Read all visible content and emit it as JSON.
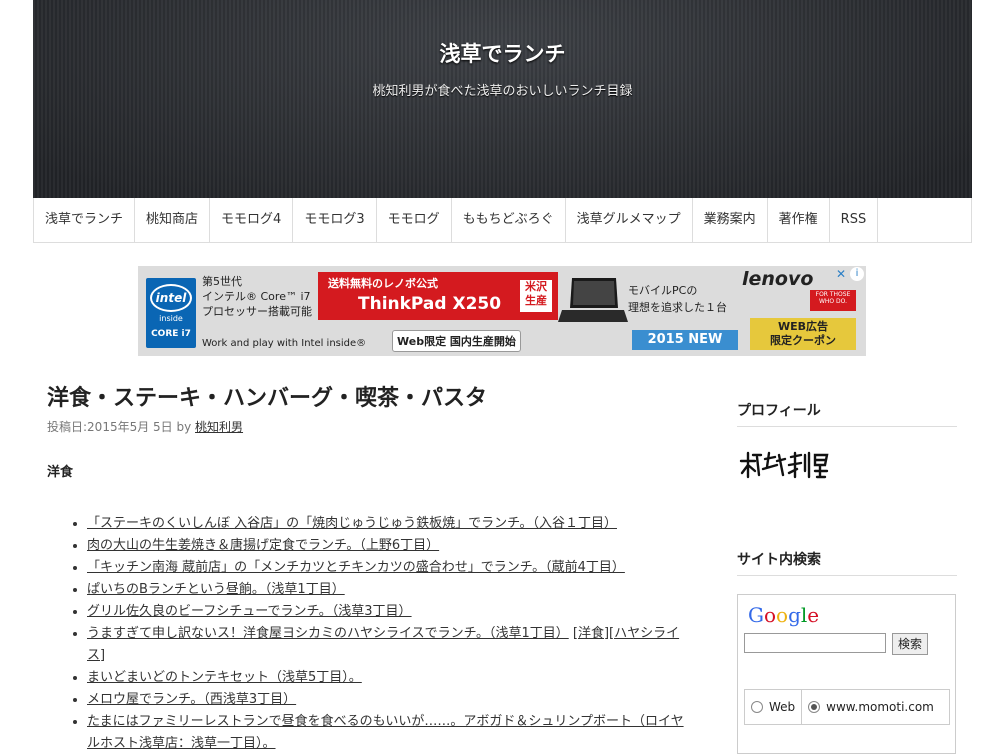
{
  "header": {
    "title": "浅草でランチ",
    "description": "桃知利男が食べた浅草のおいしいランチ目録"
  },
  "nav": [
    "浅草でランチ",
    "桃知商店",
    "モモログ4",
    "モモログ3",
    "モモログ",
    "ももちどぶろぐ",
    "浅草グルメマップ",
    "業務案内",
    "著作権",
    "RSS"
  ],
  "banner": {
    "intel_line1": "第5世代",
    "intel_line2": "インテル® Core™ i7",
    "intel_line3": "プロセッサー搭載可能",
    "intel_logo": "intel",
    "intel_inside": "inside",
    "intel_core": "CORE i7",
    "work_play": "Work and play with Intel inside®",
    "red_line1": "送料無料のレノボ公式",
    "red_line2": "ThinkPad X250",
    "seal": "米沢生産",
    "web_only": "Web限定 国内生産開始",
    "mobile_line1": "モバイルPCの",
    "mobile_line2": "理想を追求した１台",
    "new_2015": "2015 NEW",
    "lenovo": "lenovo",
    "those": "FOR THOSE WHO DO.",
    "coupon_line1": "WEB広告",
    "coupon_line2": "限定クーポン"
  },
  "post": {
    "title": "洋食・ステーキ・ハンバーグ・喫茶・パスタ",
    "meta_prefix": "投稿日:2015年5月 5日 by ",
    "author": "桃知利男",
    "section": "洋食",
    "entries": [
      {
        "link": "「ステーキのくいしんぼ 入谷店」の「焼肉じゅうじゅう鉄板焼」でランチ。（入谷１丁目）",
        "extra": ""
      },
      {
        "link": "肉の大山の牛生姜焼き＆唐揚げ定食でランチ。（上野6丁目）",
        "extra": ""
      },
      {
        "link": "「キッチン南海 蔵前店」の「メンチカツとチキンカツの盛合わせ」でランチ。（蔵前4丁目）",
        "extra": ""
      },
      {
        "link": "ぱいちのBランチという昼餉。（浅草1丁目）",
        "extra": ""
      },
      {
        "link": "グリル佐久良のビーフシチューでランチ。（浅草3丁目）",
        "extra": ""
      },
      {
        "link": "うますぎて申し訳ないス！洋食屋ヨシカミのハヤシライスでランチ。（浅草1丁目）",
        "extra": "[洋食][ハヤシライス]"
      },
      {
        "link": "まいどまいどのトンテキセット（浅草5丁目）。",
        "extra": ""
      },
      {
        "link": "メロウ屋でランチ。（西浅草3丁目）",
        "extra": ""
      },
      {
        "link": "たまにはファミリーレストランで昼食を食べるのもいいが……。アボガド＆シュリンプボート（ロイヤルホスト浅草店：浅草一丁目）。",
        "extra": ""
      }
    ]
  },
  "sidebar": {
    "profile_title": "プロフィール",
    "search_title": "サイト内検索",
    "google": "Google",
    "search_button": "検索",
    "radio_web": "Web",
    "radio_site": "www.momoti.com"
  },
  "colors": {
    "header_bg": "#2a2c30",
    "banner_red": "#d41a1f",
    "intel_blue": "#0a66b4"
  }
}
